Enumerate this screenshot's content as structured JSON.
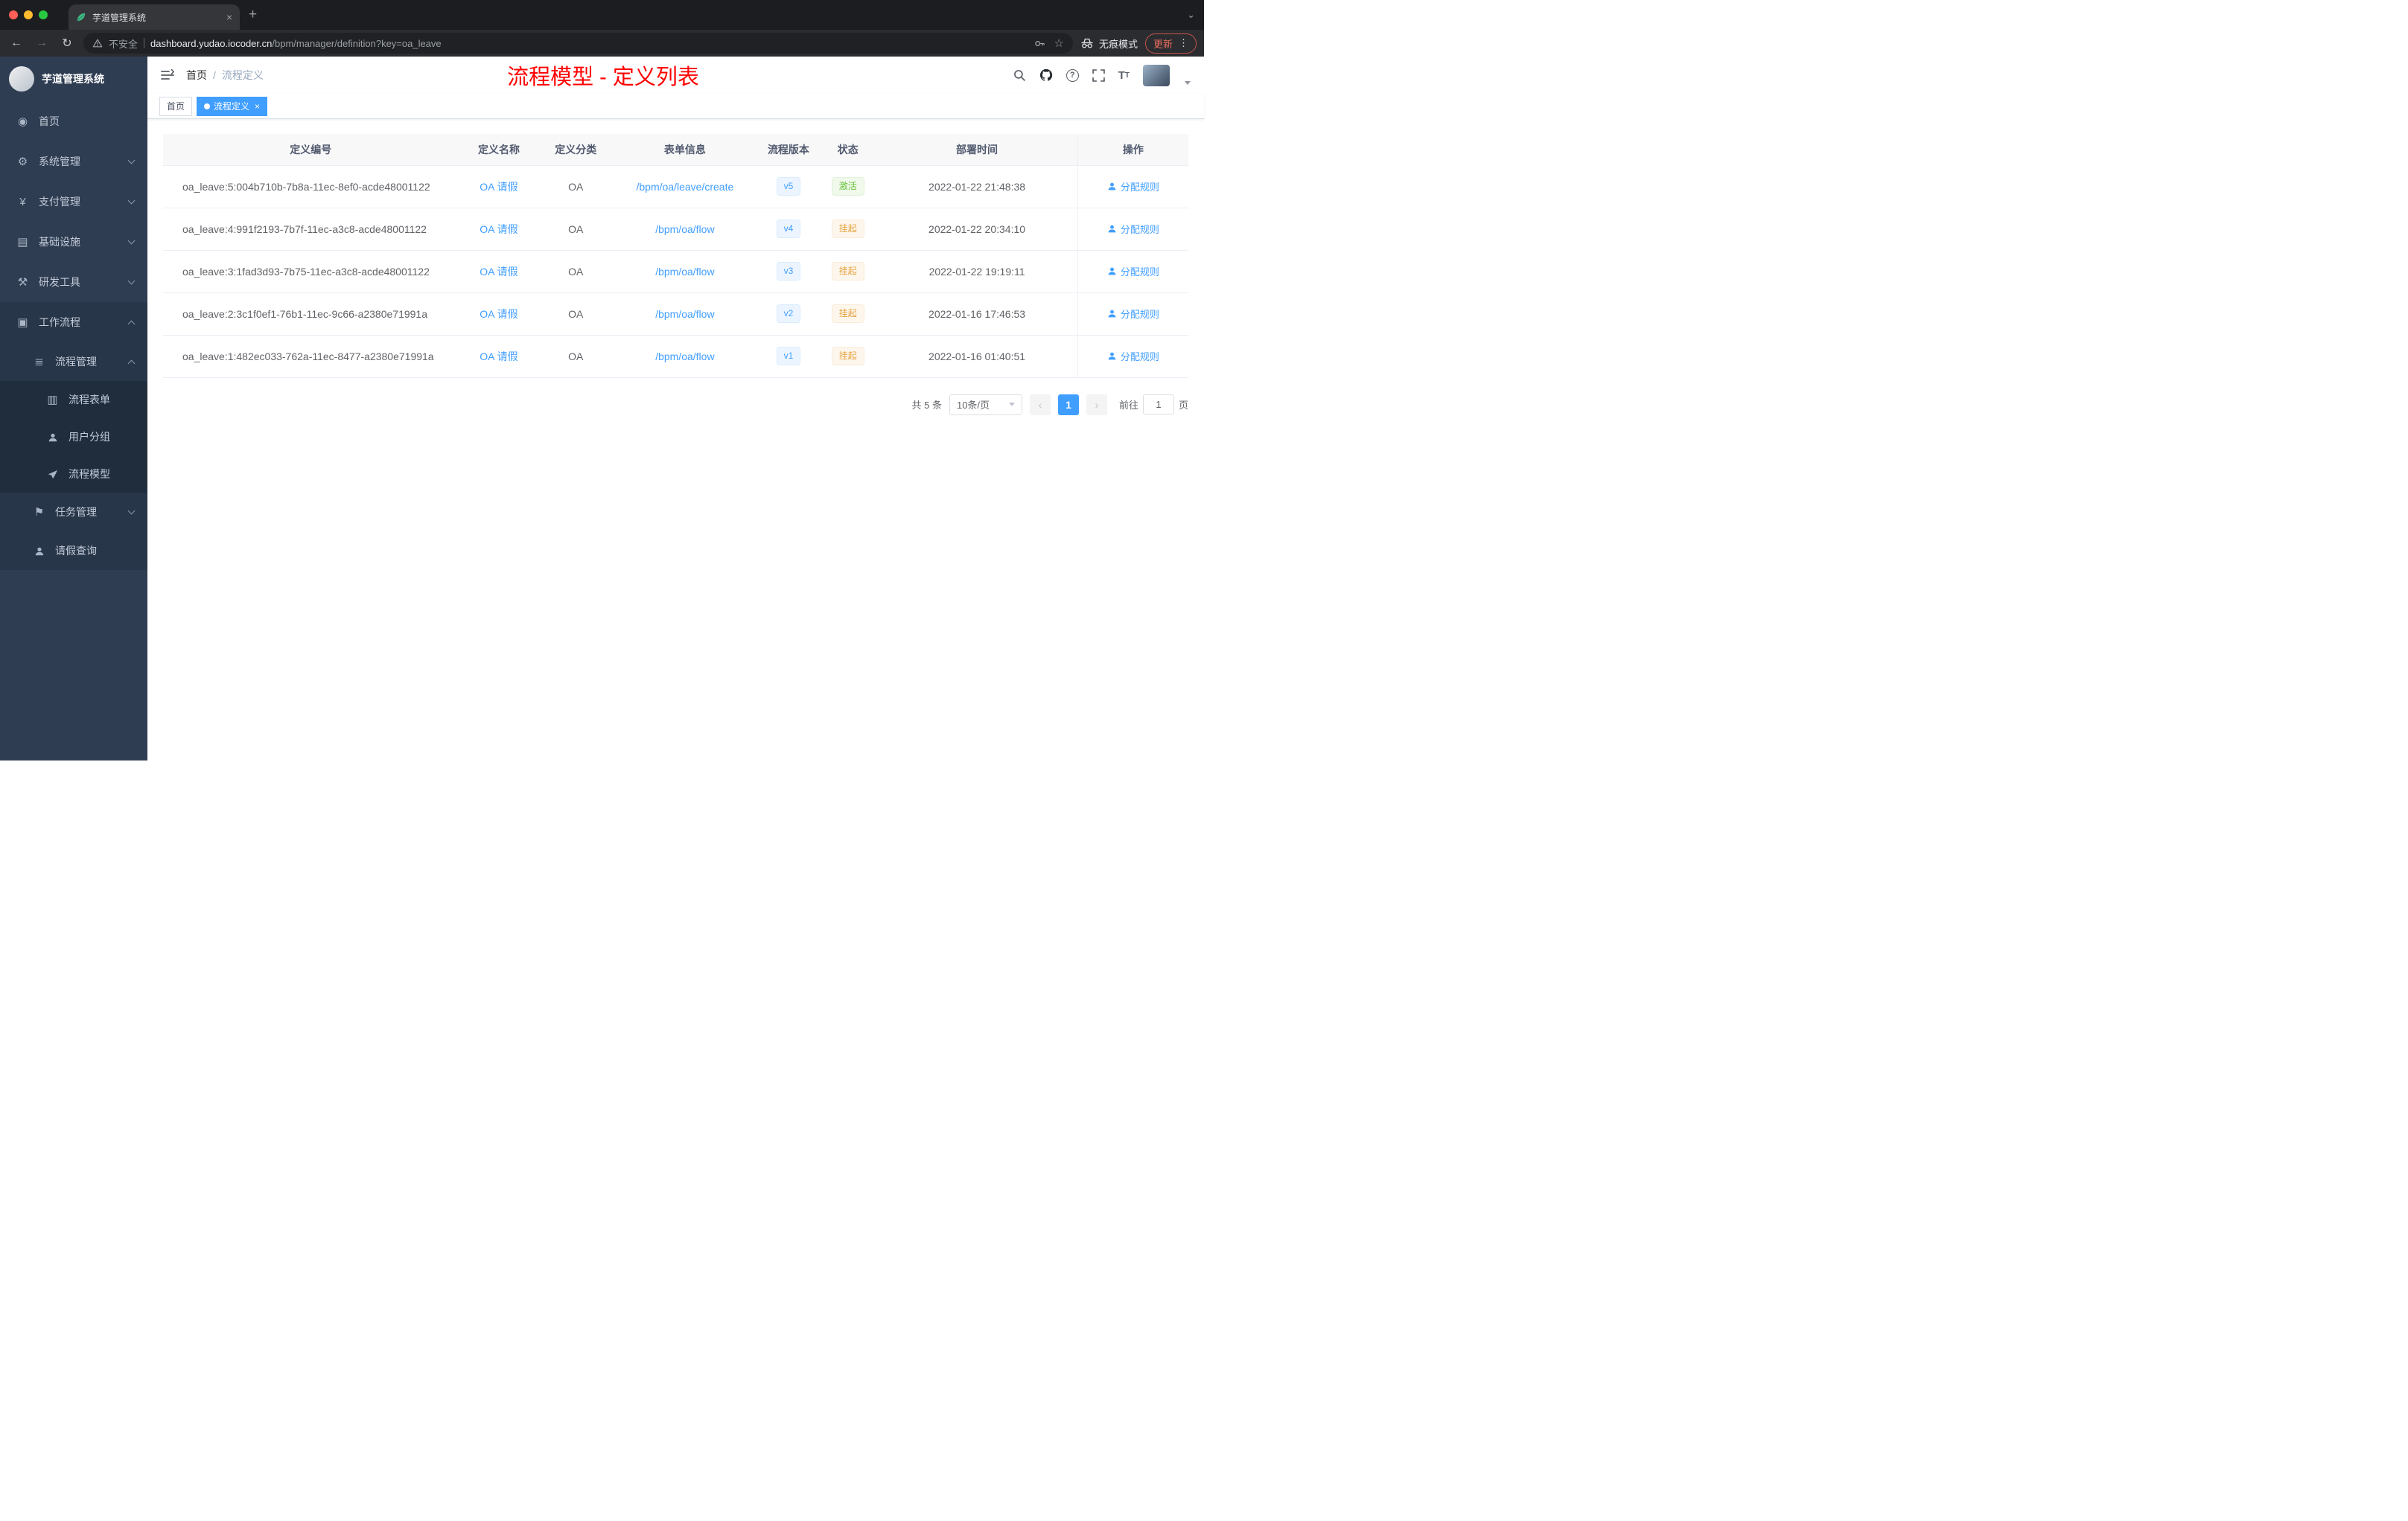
{
  "browser": {
    "tab_title": "芋道管理系统",
    "security_label": "不安全",
    "url_host": "dashboard.yudao.iocoder.cn",
    "url_path": "/bpm/manager/definition?key=oa_leave",
    "incognito_label": "无痕模式",
    "update_label": "更新"
  },
  "sidebar": {
    "brand": "芋道管理系统",
    "items": [
      {
        "label": "首页"
      },
      {
        "label": "系统管理"
      },
      {
        "label": "支付管理"
      },
      {
        "label": "基础设施"
      },
      {
        "label": "研发工具"
      },
      {
        "label": "工作流程"
      }
    ],
    "workflow": {
      "process_mgmt": "流程管理",
      "process_children": [
        "流程表单",
        "用户分组",
        "流程模型"
      ],
      "task_mgmt": "任务管理",
      "leave_query": "请假查询"
    }
  },
  "header": {
    "breadcrumb": [
      "首页",
      "流程定义"
    ],
    "annotation": "流程模型 - 定义列表"
  },
  "tags": [
    {
      "label": "首页",
      "active": false
    },
    {
      "label": "流程定义",
      "active": true
    }
  ],
  "table": {
    "headers": [
      "定义编号",
      "定义名称",
      "定义分类",
      "表单信息",
      "流程版本",
      "状态",
      "部署时间",
      "操作"
    ],
    "rows": [
      {
        "id": "oa_leave:5:004b710b-7b8a-11ec-8ef0-acde48001122",
        "name": "OA 请假",
        "category": "OA",
        "form": "/bpm/oa/leave/create",
        "version": "v5",
        "status": "激活",
        "status_type": "success",
        "deploy_time": "2022-01-22 21:48:38",
        "action": "分配规则"
      },
      {
        "id": "oa_leave:4:991f2193-7b7f-11ec-a3c8-acde48001122",
        "name": "OA 请假",
        "category": "OA",
        "form": "/bpm/oa/flow",
        "version": "v4",
        "status": "挂起",
        "status_type": "warning",
        "deploy_time": "2022-01-22 20:34:10",
        "action": "分配规则"
      },
      {
        "id": "oa_leave:3:1fad3d93-7b75-11ec-a3c8-acde48001122",
        "name": "OA 请假",
        "category": "OA",
        "form": "/bpm/oa/flow",
        "version": "v3",
        "status": "挂起",
        "status_type": "warning",
        "deploy_time": "2022-01-22 19:19:11",
        "action": "分配规则"
      },
      {
        "id": "oa_leave:2:3c1f0ef1-76b1-11ec-9c66-a2380e71991a",
        "name": "OA 请假",
        "category": "OA",
        "form": "/bpm/oa/flow",
        "version": "v2",
        "status": "挂起",
        "status_type": "warning",
        "deploy_time": "2022-01-16 17:46:53",
        "action": "分配规则"
      },
      {
        "id": "oa_leave:1:482ec033-762a-11ec-8477-a2380e71991a",
        "name": "OA 请假",
        "category": "OA",
        "form": "/bpm/oa/flow",
        "version": "v1",
        "status": "挂起",
        "status_type": "warning",
        "deploy_time": "2022-01-16 01:40:51",
        "action": "分配规则"
      }
    ]
  },
  "pagination": {
    "total": "共 5 条",
    "page_size": "10条/页",
    "current_page": "1",
    "prev_icon": "‹",
    "next_icon": "›",
    "goto_label": "前往",
    "goto_value": "1",
    "page_unit": "页"
  },
  "colors": {
    "accent": "#409eff",
    "success": "#67c23a",
    "warning": "#e6a23c",
    "annotation_red": "#ff0000",
    "sidebar_bg": "#2f3d52",
    "sidebar_sub_bg": "#1f2d3d"
  }
}
